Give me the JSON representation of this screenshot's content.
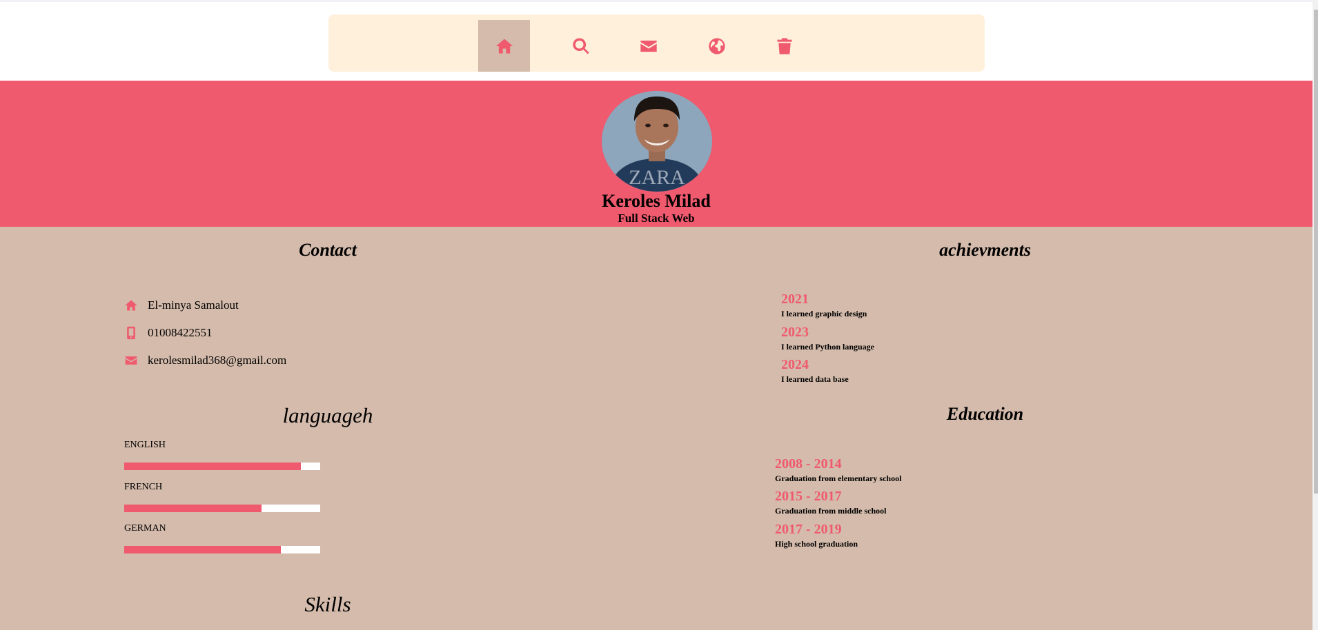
{
  "nav": {
    "items": [
      {
        "icon": "home-icon",
        "active": true
      },
      {
        "icon": "search-icon",
        "active": false
      },
      {
        "icon": "envelope-icon",
        "active": false
      },
      {
        "icon": "globe-icon",
        "active": false
      },
      {
        "icon": "trash-icon",
        "active": false
      }
    ]
  },
  "profile": {
    "name": "Keroles Milad",
    "role": "Full Stack Web"
  },
  "contact": {
    "heading": "Contact",
    "address": "El-minya Samalout",
    "phone": "01008422551",
    "email": "kerolesmilad368@gmail.com"
  },
  "languages": {
    "heading": "languageh",
    "items": [
      {
        "name": "ENGLISH",
        "level": 0.9
      },
      {
        "name": "FRENCH",
        "level": 0.7
      },
      {
        "name": "GERMAN",
        "level": 0.8
      }
    ]
  },
  "achievements": {
    "heading": "achievments",
    "items": [
      {
        "year": "2021",
        "text": "I learned graphic design"
      },
      {
        "year": "2023",
        "text": "I learned Python language"
      },
      {
        "year": "2024",
        "text": "I learned data base"
      }
    ]
  },
  "education": {
    "heading": "Education",
    "items": [
      {
        "years": "2008 - 2014",
        "text": "Graduation from elementary school"
      },
      {
        "years": "2015 - 2017",
        "text": "Graduation from middle school"
      },
      {
        "years": "2017 - 2019",
        "text": "High school graduation"
      }
    ]
  },
  "skills": {
    "heading": "Skills"
  },
  "colors": {
    "accent": "#ef5a6e",
    "background": "#d4bbab",
    "nav_bg": "#fff0dc"
  }
}
